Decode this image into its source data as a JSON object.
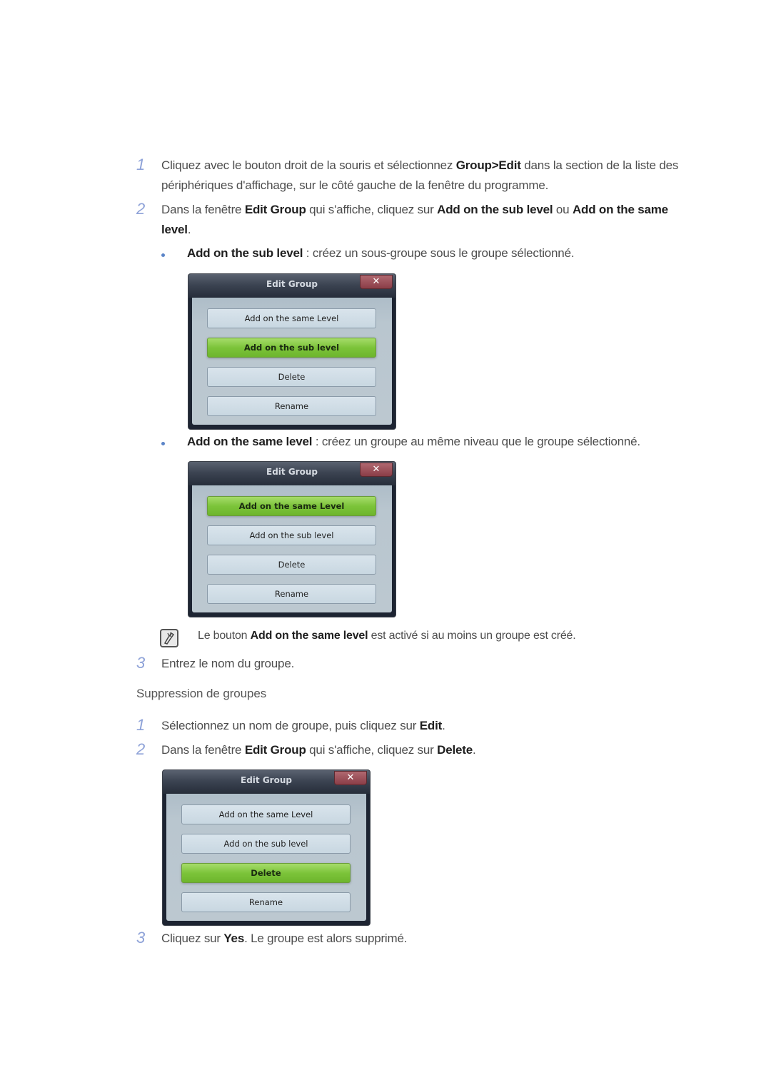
{
  "steps_group_edit": [
    {
      "number": "1",
      "lines": [
        {
          "parts": [
            {
              "t": "Cliquez avec le bouton droit de la souris et sélectionnez ",
              "b": false
            },
            {
              "t": "Group>Edit",
              "b": true
            },
            {
              "t": " dans la section de la liste des",
              "b": false
            }
          ]
        },
        {
          "parts": [
            {
              "t": "périphériques d'affichage, sur le côté gauche de la fenêtre du programme.",
              "b": false
            }
          ]
        }
      ]
    },
    {
      "number": "2",
      "lines": [
        {
          "parts": [
            {
              "t": "Dans la fenêtre ",
              "b": false
            },
            {
              "t": "Edit Group",
              "b": true
            },
            {
              "t": " qui s'affiche, cliquez sur ",
              "b": false
            },
            {
              "t": "Add on the sub level",
              "b": true
            },
            {
              "t": " ou ",
              "b": false
            },
            {
              "t": "Add on the same",
              "b": true
            }
          ]
        },
        {
          "parts": [
            {
              "t": "level",
              "b": true
            },
            {
              "t": ".",
              "b": false
            }
          ]
        }
      ]
    }
  ],
  "bullets": [
    {
      "term": "Add on the sub level",
      "desc": " : créez un sous-groupe sous le groupe sélectionné."
    },
    {
      "term": "Add on the same level",
      "desc": " : créez un groupe au même niveau que le groupe sélectionné."
    }
  ],
  "dialogs": [
    {
      "title": "Edit Group",
      "close": "✕",
      "buttons": [
        "Add on the same Level",
        "Add on the sub level",
        "Delete",
        "Rename"
      ],
      "active_index": 1
    },
    {
      "title": "Edit Group",
      "close": "✕",
      "buttons": [
        "Add on the same Level",
        "Add on the sub level",
        "Delete",
        "Rename"
      ],
      "active_index": 0
    },
    {
      "title": "Edit Group",
      "close": "✕",
      "buttons": [
        "Add on the same Level",
        "Add on the sub level",
        "Delete",
        "Rename"
      ],
      "active_index": 2
    }
  ],
  "note": {
    "icon": "note-pencil-icon",
    "parts": [
      {
        "t": "Le bouton ",
        "b": false
      },
      {
        "t": "Add on the same level",
        "b": true
      },
      {
        "t": " est activé si au moins un groupe est créé.",
        "b": false
      }
    ]
  },
  "step3_create": {
    "number": "3",
    "text": "Entrez le nom du groupe."
  },
  "section_delete": {
    "title": "Suppression de groupes",
    "steps": [
      {
        "number": "1",
        "parts": [
          {
            "t": "Sélectionnez un nom de groupe, puis cliquez sur ",
            "b": false
          },
          {
            "t": "Edit",
            "b": true
          },
          {
            "t": ".",
            "b": false
          }
        ]
      },
      {
        "number": "2",
        "parts": [
          {
            "t": "Dans la fenêtre ",
            "b": false
          },
          {
            "t": "Edit Group",
            "b": true
          },
          {
            "t": " qui s'affiche, cliquez sur ",
            "b": false
          },
          {
            "t": "Delete",
            "b": true
          },
          {
            "t": ".",
            "b": false
          }
        ]
      },
      {
        "number": "3",
        "parts": [
          {
            "t": "Cliquez sur ",
            "b": false
          },
          {
            "t": "Yes",
            "b": true
          },
          {
            "t": ". Le groupe est alors supprimé.",
            "b": false
          }
        ]
      }
    ]
  },
  "colors": {
    "step_number": "#8ea2d8",
    "bullet": "#5b84c8",
    "active_button": "#7cc43a",
    "close_button": "#9a4a54"
  }
}
